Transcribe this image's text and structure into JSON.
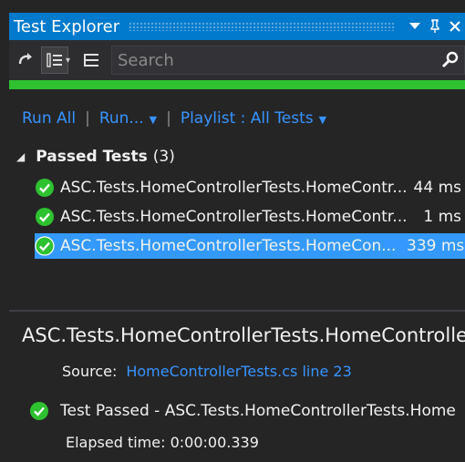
{
  "window": {
    "title": "Test Explorer",
    "dropdown_glyph": "▾",
    "pin_glyph": "📌",
    "close_glyph": "✕"
  },
  "toolbar": {
    "icons": [
      "run-icon",
      "group-by-icon",
      "playlist-icon"
    ],
    "search_placeholder": "Search"
  },
  "progress": {
    "fraction": 1.0,
    "color": "#2ec230"
  },
  "actions": {
    "run_all": "Run All",
    "separator": "|",
    "run": "Run...",
    "playlist": "Playlist : All Tests"
  },
  "group": {
    "label": "Passed Tests",
    "count": "(3)"
  },
  "tests": [
    {
      "name": "ASC.Tests.HomeControllerTests.HomeContr...",
      "duration": "44 ms",
      "selected": false
    },
    {
      "name": "ASC.Tests.HomeControllerTests.HomeContr...",
      "duration": "1 ms",
      "selected": false
    },
    {
      "name": "ASC.Tests.HomeControllerTests.HomeCon...",
      "duration": "339 ms",
      "selected": true
    }
  ],
  "detail": {
    "title": "ASC.Tests.HomeControllerTests.HomeController_",
    "source_label": "Source:",
    "source_link": "HomeControllerTests.cs line 23",
    "result_text": "Test Passed - ASC.Tests.HomeControllerTests.Home",
    "elapsed": "Elapsed time: 0:00:00.339"
  },
  "colors": {
    "accent": "#007acc",
    "link": "#3794ff",
    "pass": "#2ec230",
    "selection": "#3399ff"
  }
}
